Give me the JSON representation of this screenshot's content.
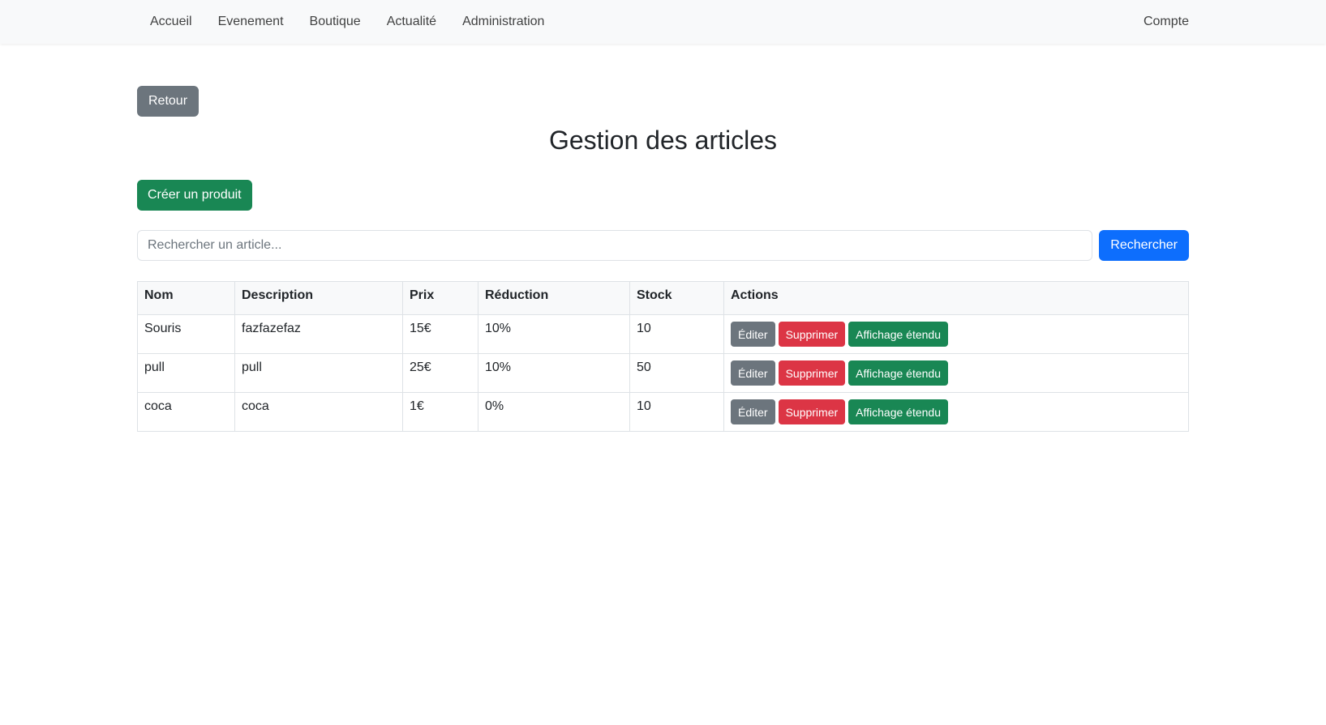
{
  "nav": {
    "items": [
      {
        "label": "Accueil"
      },
      {
        "label": "Evenement"
      },
      {
        "label": "Boutique"
      },
      {
        "label": "Actualité"
      },
      {
        "label": "Administration"
      }
    ],
    "account_label": "Compte"
  },
  "page": {
    "back_label": "Retour",
    "title": "Gestion des articles",
    "create_label": "Créer un produit"
  },
  "search": {
    "value": "",
    "placeholder": "Rechercher un article...",
    "button_label": "Rechercher"
  },
  "table": {
    "headers": [
      "Nom",
      "Description",
      "Prix",
      "Réduction",
      "Stock",
      "Actions"
    ],
    "rows": [
      {
        "nom": "Souris",
        "description": "fazfazefaz",
        "prix": "15€",
        "reduction": "10%",
        "stock": "10"
      },
      {
        "nom": "pull",
        "description": "pull",
        "prix": "25€",
        "reduction": "10%",
        "stock": "50"
      },
      {
        "nom": "coca",
        "description": "coca",
        "prix": "1€",
        "reduction": "0%",
        "stock": "10"
      }
    ],
    "actions": {
      "edit_label": "Éditer",
      "delete_label": "Supprimer",
      "expand_label": "Affichage étendu"
    }
  },
  "colors": {
    "navbar_bg": "#f8f9fa",
    "secondary": "#6c757d",
    "success": "#198754",
    "danger": "#dc3545",
    "primary": "#0d6efd"
  }
}
